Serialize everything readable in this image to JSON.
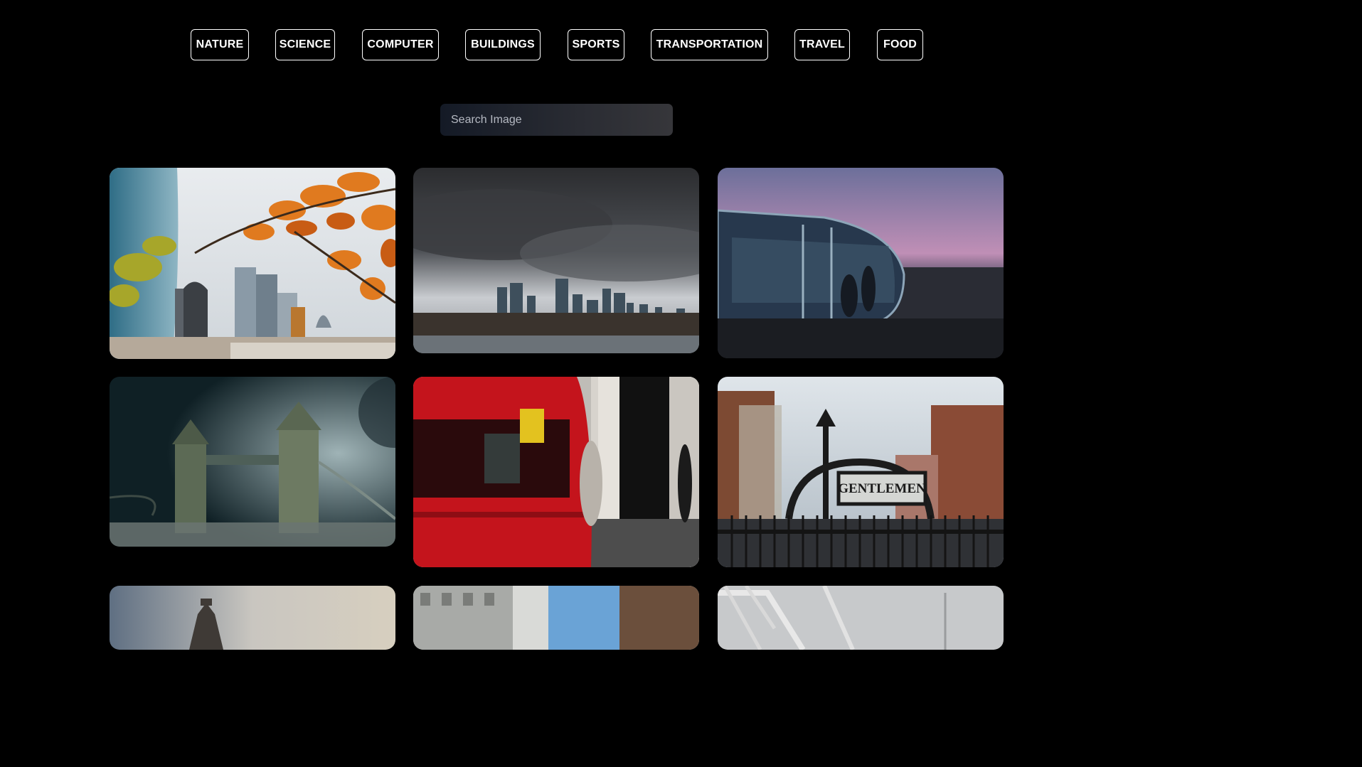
{
  "nav": {
    "categories": [
      "NATURE",
      "SCIENCE",
      "COMPUTER",
      "BUILDINGS",
      "SPORTS",
      "TRANSPORTATION",
      "TRAVEL",
      "FOOD"
    ]
  },
  "search": {
    "placeholder": "Search Image"
  },
  "gallery": {
    "images": [
      {
        "subject": "autumn leaves in front of city skyscrapers"
      },
      {
        "subject": "stormy clouds over city skyline"
      },
      {
        "subject": "observation wheel capsule at dusk"
      },
      {
        "subject": "tower bridge in fog at night"
      },
      {
        "subject": "red double-decker bus motion blur"
      },
      {
        "subject": "gentlemen sign with lamp post"
      },
      {
        "subject": "tower bridge under cloudy sky"
      },
      {
        "subject": "street between buildings"
      },
      {
        "subject": "observation wheel structure"
      }
    ],
    "sign_text": "GENTLEMEN"
  },
  "colors": {
    "background": "#000000",
    "button_border": "#ffffff",
    "text": "#ffffff"
  }
}
